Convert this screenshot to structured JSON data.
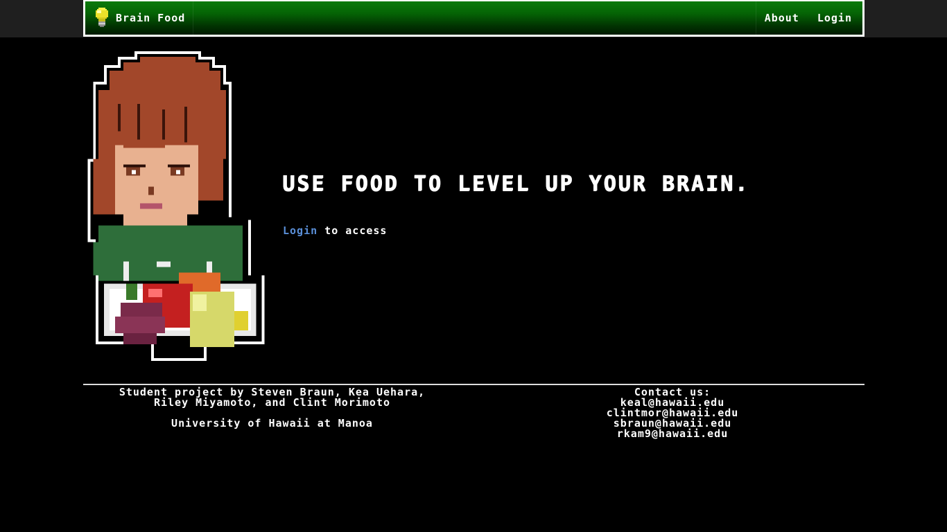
{
  "nav": {
    "brand": "Brain Food",
    "links": [
      "About",
      "Login"
    ]
  },
  "hero": {
    "headline": "USE FOOD TO LEVEL UP YOUR BRAIN.",
    "login_link": "Login",
    "login_suffix": " to access"
  },
  "footer": {
    "credits_line1": "Student project by Steven Braun, Kea Uehara,",
    "credits_line2": "Riley Miyamoto, and Clint Morimoto",
    "university": "University of Hawaii at Manoa",
    "contact_title": "Contact us:",
    "emails": [
      "keal@hawaii.edu",
      "clintmor@hawaii.edu",
      "sbraun@hawaii.edu",
      "rkam9@hawaii.edu"
    ]
  },
  "colors": {
    "nav_green": "#056505",
    "link_blue": "#5a8fd8",
    "background": "#000000"
  }
}
